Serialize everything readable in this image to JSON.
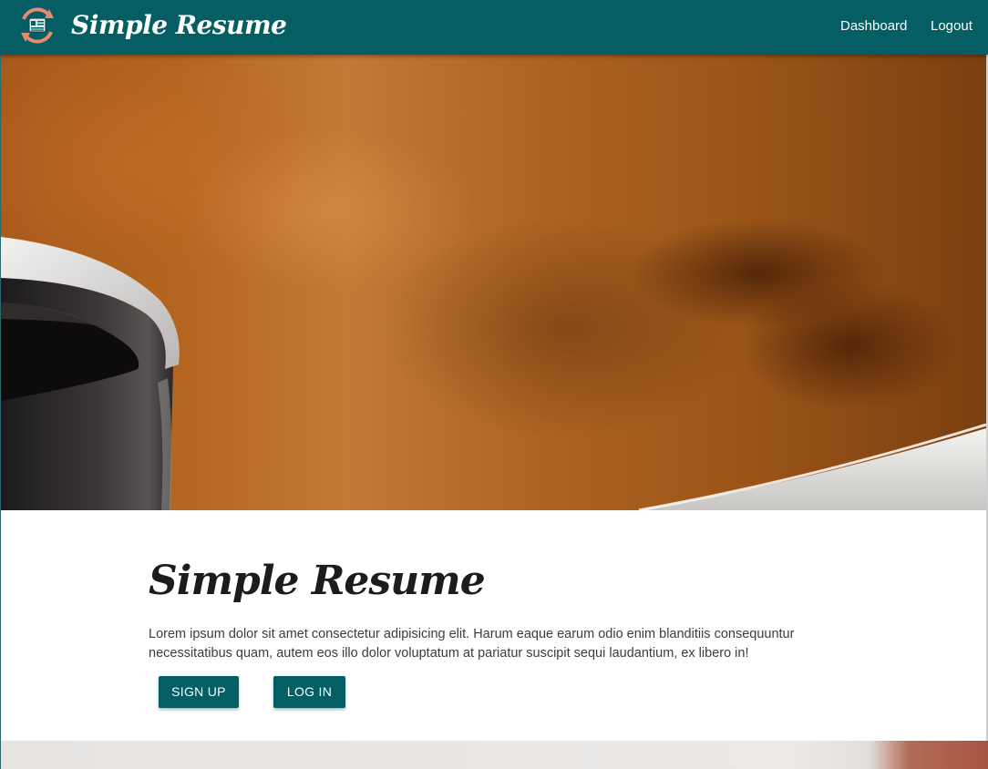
{
  "navbar": {
    "brand_name": "Simple Resume",
    "logo_icon": "resume-refresh-logo-icon",
    "links": [
      {
        "label": "Dashboard"
      },
      {
        "label": "Logout"
      }
    ],
    "color": "#045e63"
  },
  "hero": {
    "image_icon": "coffee-mug-photo"
  },
  "main": {
    "title": "Simple Resume",
    "description": "Lorem ipsum dolor sit amet consectetur adipisicing elit. Harum eaque earum odio enim blanditiis consequuntur necessitatibus quam, autem eos illo dolor voluptatum at pariatur suscipit sequi laudantium, ex libero in!",
    "buttons": {
      "signup_label": "SIGN UP",
      "login_label": "LOG IN"
    }
  },
  "colors": {
    "primary": "#045e63",
    "accent": "#e88a6e"
  }
}
